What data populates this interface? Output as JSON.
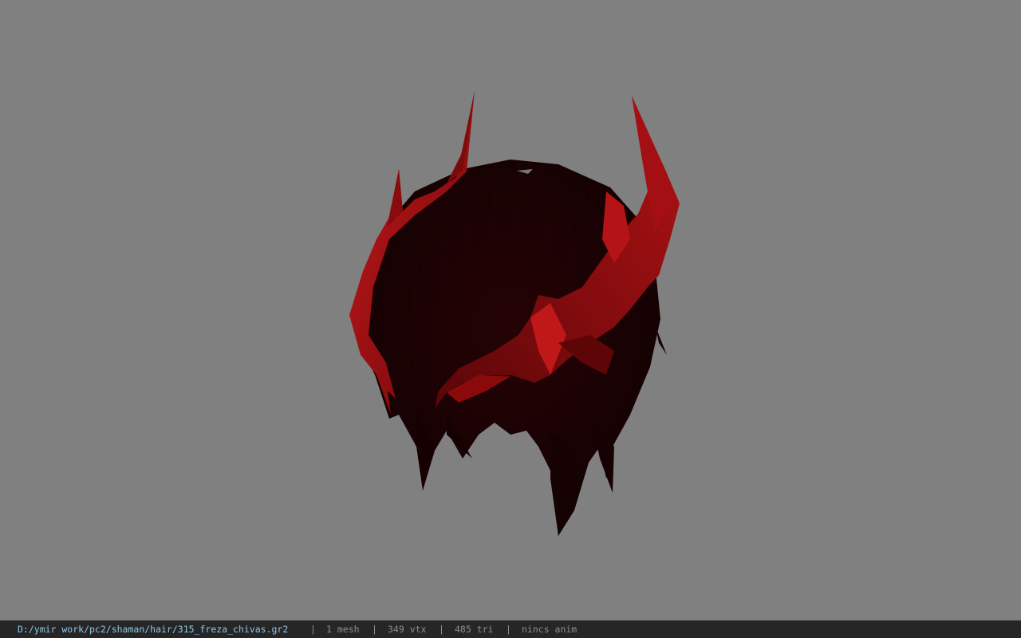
{
  "viewport": {
    "background_color": "#808080",
    "model": {
      "label": "hair model",
      "colors": {
        "dark": "#1a0203",
        "red": "#9a0d10",
        "red_highlight": "#c4181a"
      }
    }
  },
  "statusbar": {
    "file_path": "D:/ymir work/pc2/shaman/hair/315_freza_chivas.gr2",
    "separator": "|",
    "mesh_count": "1 mesh",
    "vertex_count": "349 vtx",
    "triangle_count": "485 tri",
    "anim_status": "nincs anim",
    "path_color": "#8fc6e6",
    "text_color": "#8f8f8f",
    "background_color": "#262626"
  }
}
